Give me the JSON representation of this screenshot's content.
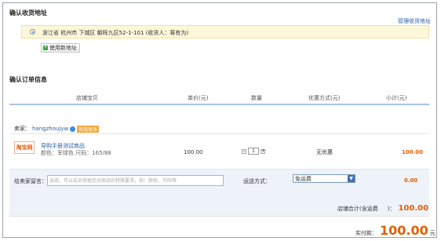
{
  "address_section": {
    "title": "确认收货地址",
    "manage_link": "管理收货地址",
    "selected_address": "浙江省  杭州市  下城区  朝晖九区52-1-101  (收货人：蒋有为)",
    "new_address_button": "使用新地址"
  },
  "order_section": {
    "title": "确认订单信息",
    "columns": [
      "店铺宝贝",
      "单价(元)",
      "数量",
      "优惠方式(元)",
      "小计(元)"
    ],
    "seller_label": "卖家：",
    "seller_name": "hangzhoujyw",
    "contact_tag": "和我联系"
  },
  "item": {
    "logo_text": "淘宝网",
    "name": "导购手册测试商品",
    "attrs": "颜色：军绿色  尺码：165/88",
    "price": "100.00",
    "quantity": "1",
    "discount": "无优惠",
    "subtotal": "100.00"
  },
  "message": {
    "label": "给卖家留言：",
    "placeholder": "选填，可以告诉卖家您对商品的特殊要求，如：颜色、尺码等"
  },
  "shipping": {
    "label": "运送方式：",
    "selected": "免运费",
    "fee": "0.00"
  },
  "totals": {
    "shop_total_label": "店铺合计(含运费",
    "shop_total_suffix": ")：",
    "shop_total": "100.00",
    "payable_label": "实付款：",
    "payable": "100.00",
    "currency": "元"
  }
}
